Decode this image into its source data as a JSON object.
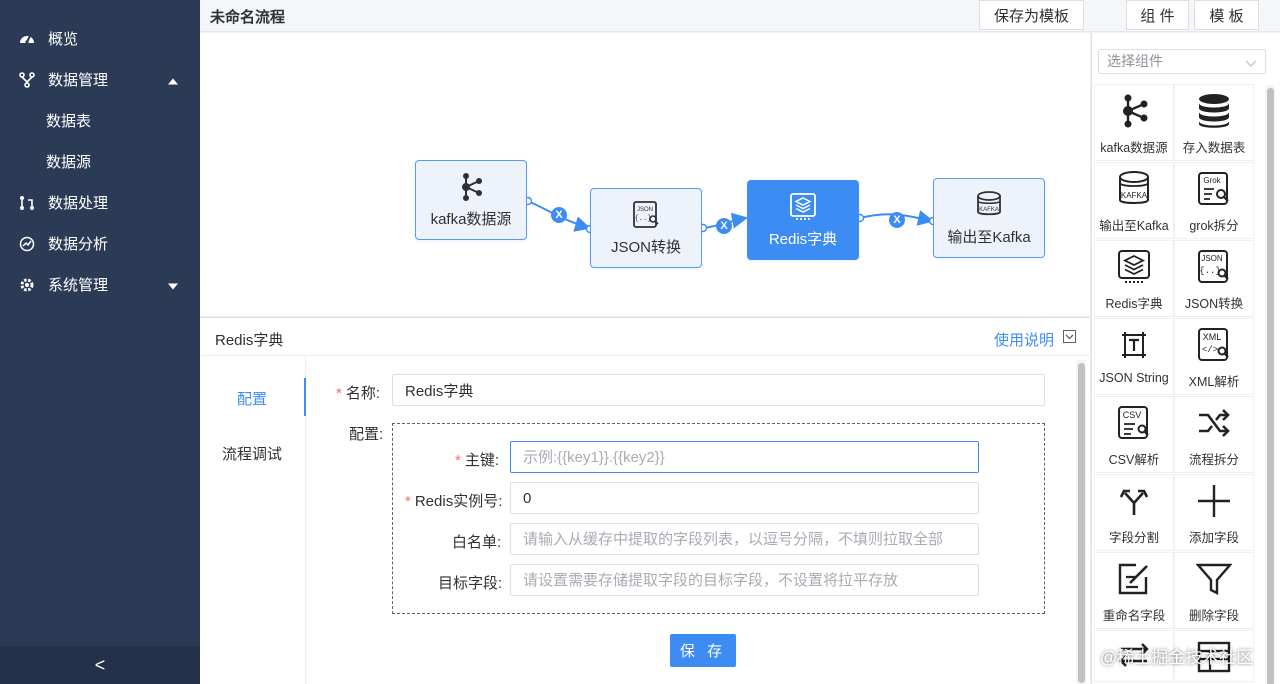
{
  "sidebar": {
    "items": [
      {
        "label": "概览",
        "icon": "dashboard-icon"
      },
      {
        "label": "数据管理",
        "icon": "branch-icon",
        "expanded": true
      },
      {
        "label": "数据表",
        "sub": true
      },
      {
        "label": "数据源",
        "sub": true
      },
      {
        "label": "数据处理",
        "icon": "process-icon"
      },
      {
        "label": "数据分析",
        "icon": "analysis-icon"
      },
      {
        "label": "系统管理",
        "icon": "gear-icon",
        "expanded": false
      }
    ],
    "collapse": "<"
  },
  "topbar": {
    "title": "未命名流程",
    "save_template": "保存为模板",
    "components": "组 件",
    "templates": "模 板"
  },
  "flow": {
    "nodes": [
      {
        "label": "kafka数据源",
        "icon": "kafka-icon",
        "active": false
      },
      {
        "label": "JSON转换",
        "icon": "json-icon",
        "active": false
      },
      {
        "label": "Redis字典",
        "icon": "redis-icon",
        "active": true
      },
      {
        "label": "输出至Kafka",
        "icon": "db-kafka-icon",
        "active": false
      }
    ],
    "edge_close": "X"
  },
  "panel": {
    "title": "Redis字典",
    "help": "使用说明",
    "tabs": [
      "配置",
      "流程调试"
    ],
    "active_tab": "配置",
    "form": {
      "name_label": "名称:",
      "name_value": "Redis字典",
      "config_label": "配置:",
      "key_label": "主键:",
      "key_placeholder": "示例:{{key1}}.{{key2}}",
      "instance_label": "Redis实例号:",
      "instance_value": "0",
      "whitelist_label": "白名单:",
      "whitelist_placeholder": "请输入从缓存中提取的字段列表，以逗号分隔，不填则拉取全部",
      "target_label": "目标字段:",
      "target_placeholder": "请设置需要存储提取字段的目标字段，不设置将拉平存放",
      "required_mark": "*"
    },
    "save": "保 存"
  },
  "palette": {
    "select_placeholder": "选择组件",
    "items": [
      {
        "label": "kafka数据源",
        "icon": "kafka-icon"
      },
      {
        "label": "存入数据表",
        "icon": "database-icon"
      },
      {
        "label": "输出至Kafka",
        "icon": "db-kafka-icon"
      },
      {
        "label": "grok拆分",
        "icon": "grok-icon"
      },
      {
        "label": "Redis字典",
        "icon": "redis-icon"
      },
      {
        "label": "JSON转换",
        "icon": "json-icon"
      },
      {
        "label": "JSON String",
        "icon": "json-string-icon"
      },
      {
        "label": "XML解析",
        "icon": "xml-icon"
      },
      {
        "label": "CSV解析",
        "icon": "csv-icon"
      },
      {
        "label": "流程拆分",
        "icon": "shuffle-icon"
      },
      {
        "label": "字段分割",
        "icon": "split-icon"
      },
      {
        "label": "添加字段",
        "icon": "plus-icon"
      },
      {
        "label": "重命名字段",
        "icon": "rename-icon"
      },
      {
        "label": "删除字段",
        "icon": "filter-icon"
      }
    ]
  },
  "watermark": "@稀土掘金技术社区",
  "colors": {
    "sidebar": "#2b3a55",
    "accent": "#3d8cf3",
    "required": "#f56c6c"
  }
}
